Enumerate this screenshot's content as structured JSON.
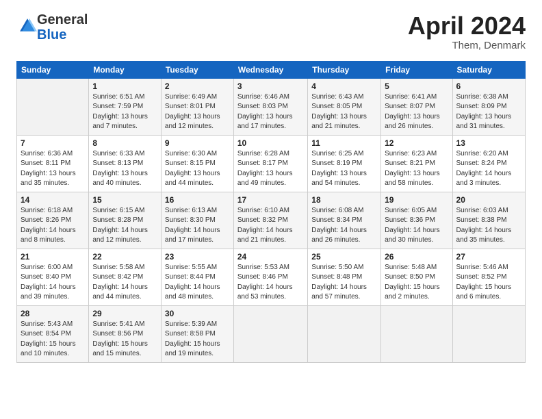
{
  "header": {
    "logo_general": "General",
    "logo_blue": "Blue",
    "title": "April 2024",
    "location": "Them, Denmark"
  },
  "columns": [
    "Sunday",
    "Monday",
    "Tuesday",
    "Wednesday",
    "Thursday",
    "Friday",
    "Saturday"
  ],
  "weeks": [
    [
      {
        "day": "",
        "empty": true
      },
      {
        "day": "1",
        "sunrise": "Sunrise: 6:51 AM",
        "sunset": "Sunset: 7:59 PM",
        "daylight": "Daylight: 13 hours and 7 minutes."
      },
      {
        "day": "2",
        "sunrise": "Sunrise: 6:49 AM",
        "sunset": "Sunset: 8:01 PM",
        "daylight": "Daylight: 13 hours and 12 minutes."
      },
      {
        "day": "3",
        "sunrise": "Sunrise: 6:46 AM",
        "sunset": "Sunset: 8:03 PM",
        "daylight": "Daylight: 13 hours and 17 minutes."
      },
      {
        "day": "4",
        "sunrise": "Sunrise: 6:43 AM",
        "sunset": "Sunset: 8:05 PM",
        "daylight": "Daylight: 13 hours and 21 minutes."
      },
      {
        "day": "5",
        "sunrise": "Sunrise: 6:41 AM",
        "sunset": "Sunset: 8:07 PM",
        "daylight": "Daylight: 13 hours and 26 minutes."
      },
      {
        "day": "6",
        "sunrise": "Sunrise: 6:38 AM",
        "sunset": "Sunset: 8:09 PM",
        "daylight": "Daylight: 13 hours and 31 minutes."
      }
    ],
    [
      {
        "day": "7",
        "sunrise": "Sunrise: 6:36 AM",
        "sunset": "Sunset: 8:11 PM",
        "daylight": "Daylight: 13 hours and 35 minutes."
      },
      {
        "day": "8",
        "sunrise": "Sunrise: 6:33 AM",
        "sunset": "Sunset: 8:13 PM",
        "daylight": "Daylight: 13 hours and 40 minutes."
      },
      {
        "day": "9",
        "sunrise": "Sunrise: 6:30 AM",
        "sunset": "Sunset: 8:15 PM",
        "daylight": "Daylight: 13 hours and 44 minutes."
      },
      {
        "day": "10",
        "sunrise": "Sunrise: 6:28 AM",
        "sunset": "Sunset: 8:17 PM",
        "daylight": "Daylight: 13 hours and 49 minutes."
      },
      {
        "day": "11",
        "sunrise": "Sunrise: 6:25 AM",
        "sunset": "Sunset: 8:19 PM",
        "daylight": "Daylight: 13 hours and 54 minutes."
      },
      {
        "day": "12",
        "sunrise": "Sunrise: 6:23 AM",
        "sunset": "Sunset: 8:21 PM",
        "daylight": "Daylight: 13 hours and 58 minutes."
      },
      {
        "day": "13",
        "sunrise": "Sunrise: 6:20 AM",
        "sunset": "Sunset: 8:24 PM",
        "daylight": "Daylight: 14 hours and 3 minutes."
      }
    ],
    [
      {
        "day": "14",
        "sunrise": "Sunrise: 6:18 AM",
        "sunset": "Sunset: 8:26 PM",
        "daylight": "Daylight: 14 hours and 8 minutes."
      },
      {
        "day": "15",
        "sunrise": "Sunrise: 6:15 AM",
        "sunset": "Sunset: 8:28 PM",
        "daylight": "Daylight: 14 hours and 12 minutes."
      },
      {
        "day": "16",
        "sunrise": "Sunrise: 6:13 AM",
        "sunset": "Sunset: 8:30 PM",
        "daylight": "Daylight: 14 hours and 17 minutes."
      },
      {
        "day": "17",
        "sunrise": "Sunrise: 6:10 AM",
        "sunset": "Sunset: 8:32 PM",
        "daylight": "Daylight: 14 hours and 21 minutes."
      },
      {
        "day": "18",
        "sunrise": "Sunrise: 6:08 AM",
        "sunset": "Sunset: 8:34 PM",
        "daylight": "Daylight: 14 hours and 26 minutes."
      },
      {
        "day": "19",
        "sunrise": "Sunrise: 6:05 AM",
        "sunset": "Sunset: 8:36 PM",
        "daylight": "Daylight: 14 hours and 30 minutes."
      },
      {
        "day": "20",
        "sunrise": "Sunrise: 6:03 AM",
        "sunset": "Sunset: 8:38 PM",
        "daylight": "Daylight: 14 hours and 35 minutes."
      }
    ],
    [
      {
        "day": "21",
        "sunrise": "Sunrise: 6:00 AM",
        "sunset": "Sunset: 8:40 PM",
        "daylight": "Daylight: 14 hours and 39 minutes."
      },
      {
        "day": "22",
        "sunrise": "Sunrise: 5:58 AM",
        "sunset": "Sunset: 8:42 PM",
        "daylight": "Daylight: 14 hours and 44 minutes."
      },
      {
        "day": "23",
        "sunrise": "Sunrise: 5:55 AM",
        "sunset": "Sunset: 8:44 PM",
        "daylight": "Daylight: 14 hours and 48 minutes."
      },
      {
        "day": "24",
        "sunrise": "Sunrise: 5:53 AM",
        "sunset": "Sunset: 8:46 PM",
        "daylight": "Daylight: 14 hours and 53 minutes."
      },
      {
        "day": "25",
        "sunrise": "Sunrise: 5:50 AM",
        "sunset": "Sunset: 8:48 PM",
        "daylight": "Daylight: 14 hours and 57 minutes."
      },
      {
        "day": "26",
        "sunrise": "Sunrise: 5:48 AM",
        "sunset": "Sunset: 8:50 PM",
        "daylight": "Daylight: 15 hours and 2 minutes."
      },
      {
        "day": "27",
        "sunrise": "Sunrise: 5:46 AM",
        "sunset": "Sunset: 8:52 PM",
        "daylight": "Daylight: 15 hours and 6 minutes."
      }
    ],
    [
      {
        "day": "28",
        "sunrise": "Sunrise: 5:43 AM",
        "sunset": "Sunset: 8:54 PM",
        "daylight": "Daylight: 15 hours and 10 minutes."
      },
      {
        "day": "29",
        "sunrise": "Sunrise: 5:41 AM",
        "sunset": "Sunset: 8:56 PM",
        "daylight": "Daylight: 15 hours and 15 minutes."
      },
      {
        "day": "30",
        "sunrise": "Sunrise: 5:39 AM",
        "sunset": "Sunset: 8:58 PM",
        "daylight": "Daylight: 15 hours and 19 minutes."
      },
      {
        "day": "",
        "empty": true
      },
      {
        "day": "",
        "empty": true
      },
      {
        "day": "",
        "empty": true
      },
      {
        "day": "",
        "empty": true
      }
    ]
  ]
}
